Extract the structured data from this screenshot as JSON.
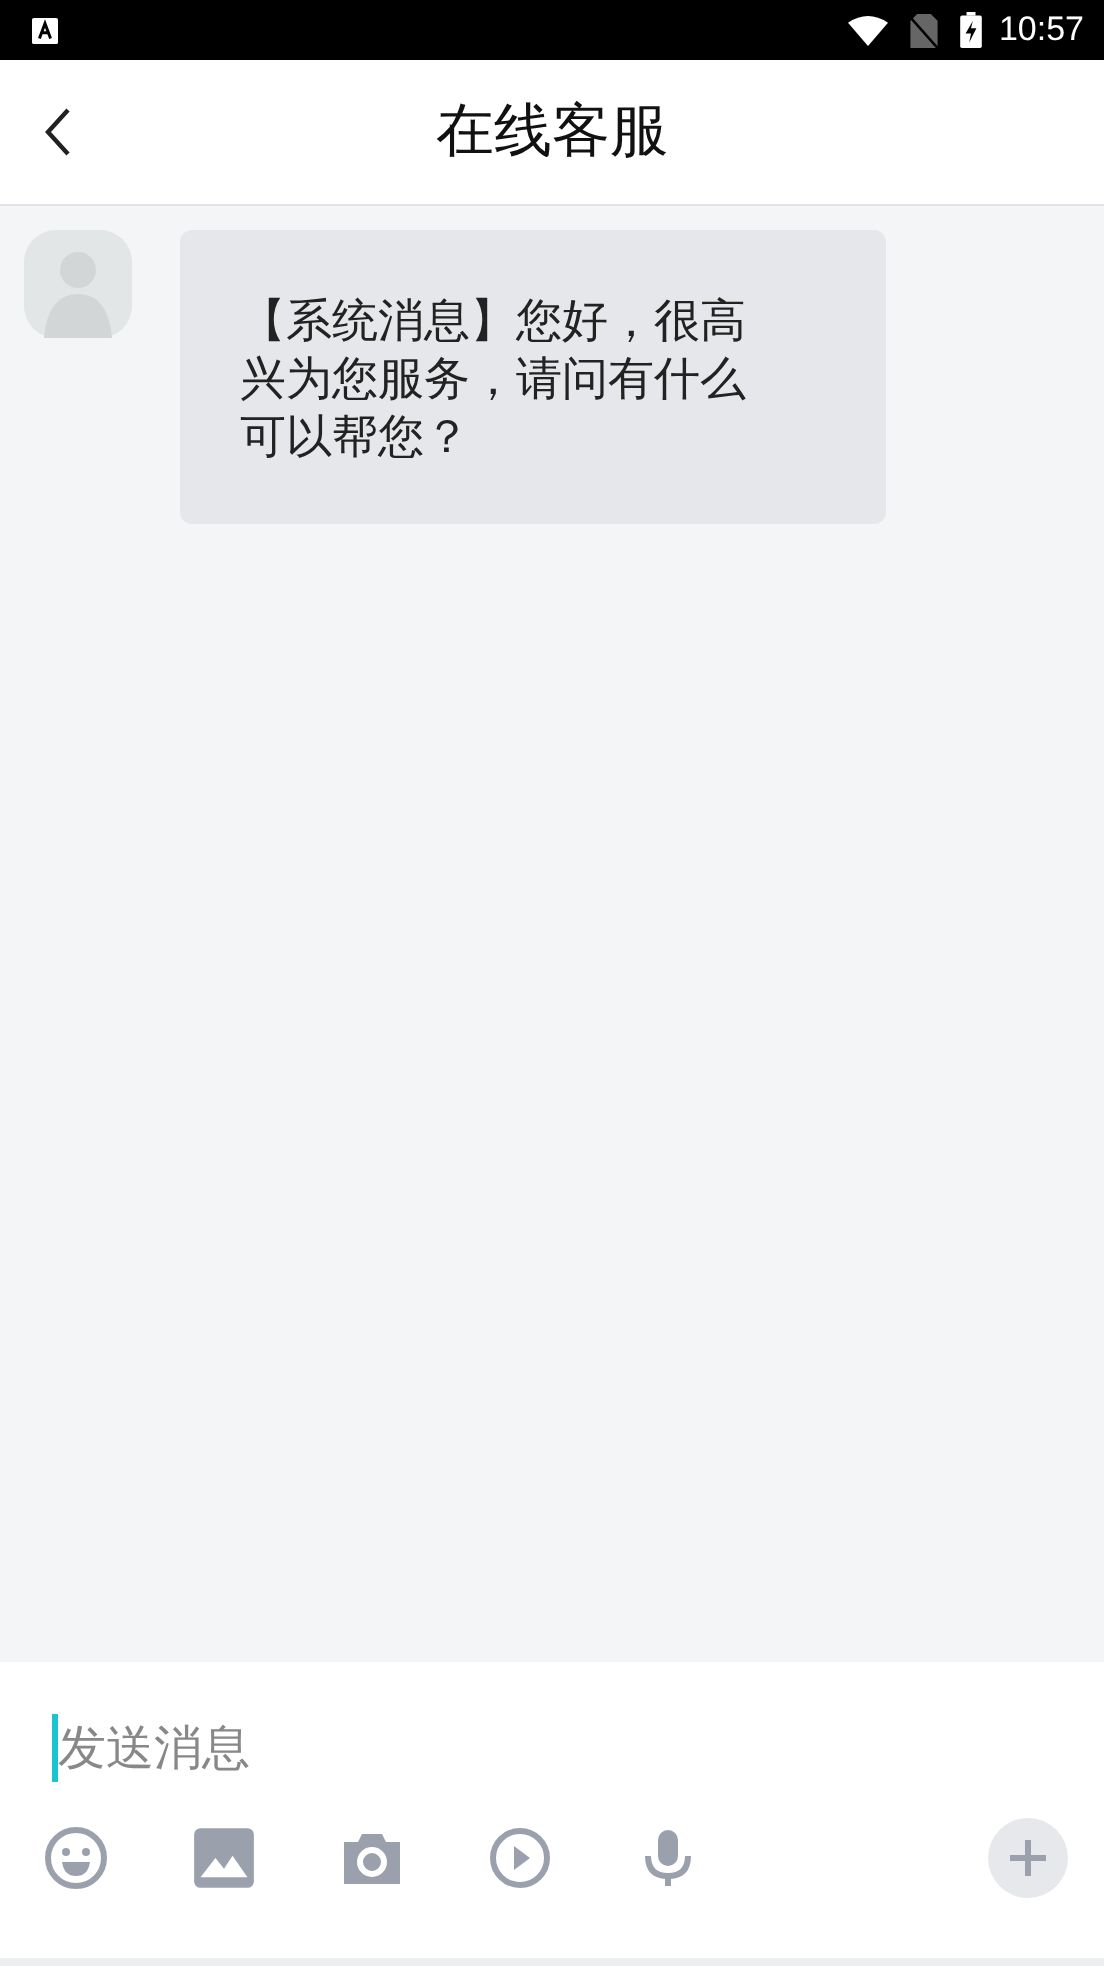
{
  "status_bar": {
    "time": "10:57"
  },
  "header": {
    "title": "在线客服"
  },
  "messages": [
    {
      "kind": "incoming",
      "text": "【系统消息】您好，很高兴为您服务，请问有什么可以帮您？"
    }
  ],
  "composer": {
    "placeholder": "发送消息"
  }
}
